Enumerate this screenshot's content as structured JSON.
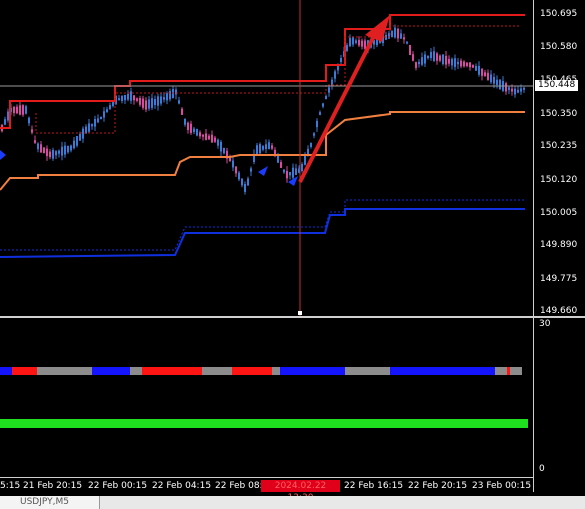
{
  "symbol_tab": "USDJPY,M5",
  "price_axis": {
    "labels": [
      "150.695",
      "150.580",
      "150.465",
      "150.350",
      "150.235",
      "150.120",
      "150.005",
      "149.890",
      "149.775",
      "149.660"
    ],
    "current_price": "150.448"
  },
  "indicator_axis": {
    "top": "30",
    "bottom": "0"
  },
  "time_axis": {
    "labels": [
      "5:15",
      "21 Feb 20:15",
      "22 Feb 00:15",
      "22 Feb 04:15",
      "22 Feb 08:",
      "22 Feb 16:15",
      "22 Feb 20:15",
      "23 Feb 00:15"
    ],
    "crosshair_time": "2024.02.22 13:30"
  },
  "colors": {
    "upper_band": "#e31b1b",
    "upper_dotted": "#c21818",
    "orange_line": "#f08040",
    "lower_band": "#1030e0",
    "bull_candle": "#3a7bd5",
    "bear_candle": "#d94aa0",
    "arrow": "#e02020",
    "signal_green": "#1fe01f",
    "crosshair": "#c03030"
  },
  "signal_bar": [
    "blue",
    "red",
    "gray",
    "blue",
    "gray",
    "red",
    "gray",
    "red",
    "gray",
    "blue",
    "gray",
    "blue",
    "gray",
    "red",
    "gray"
  ]
}
